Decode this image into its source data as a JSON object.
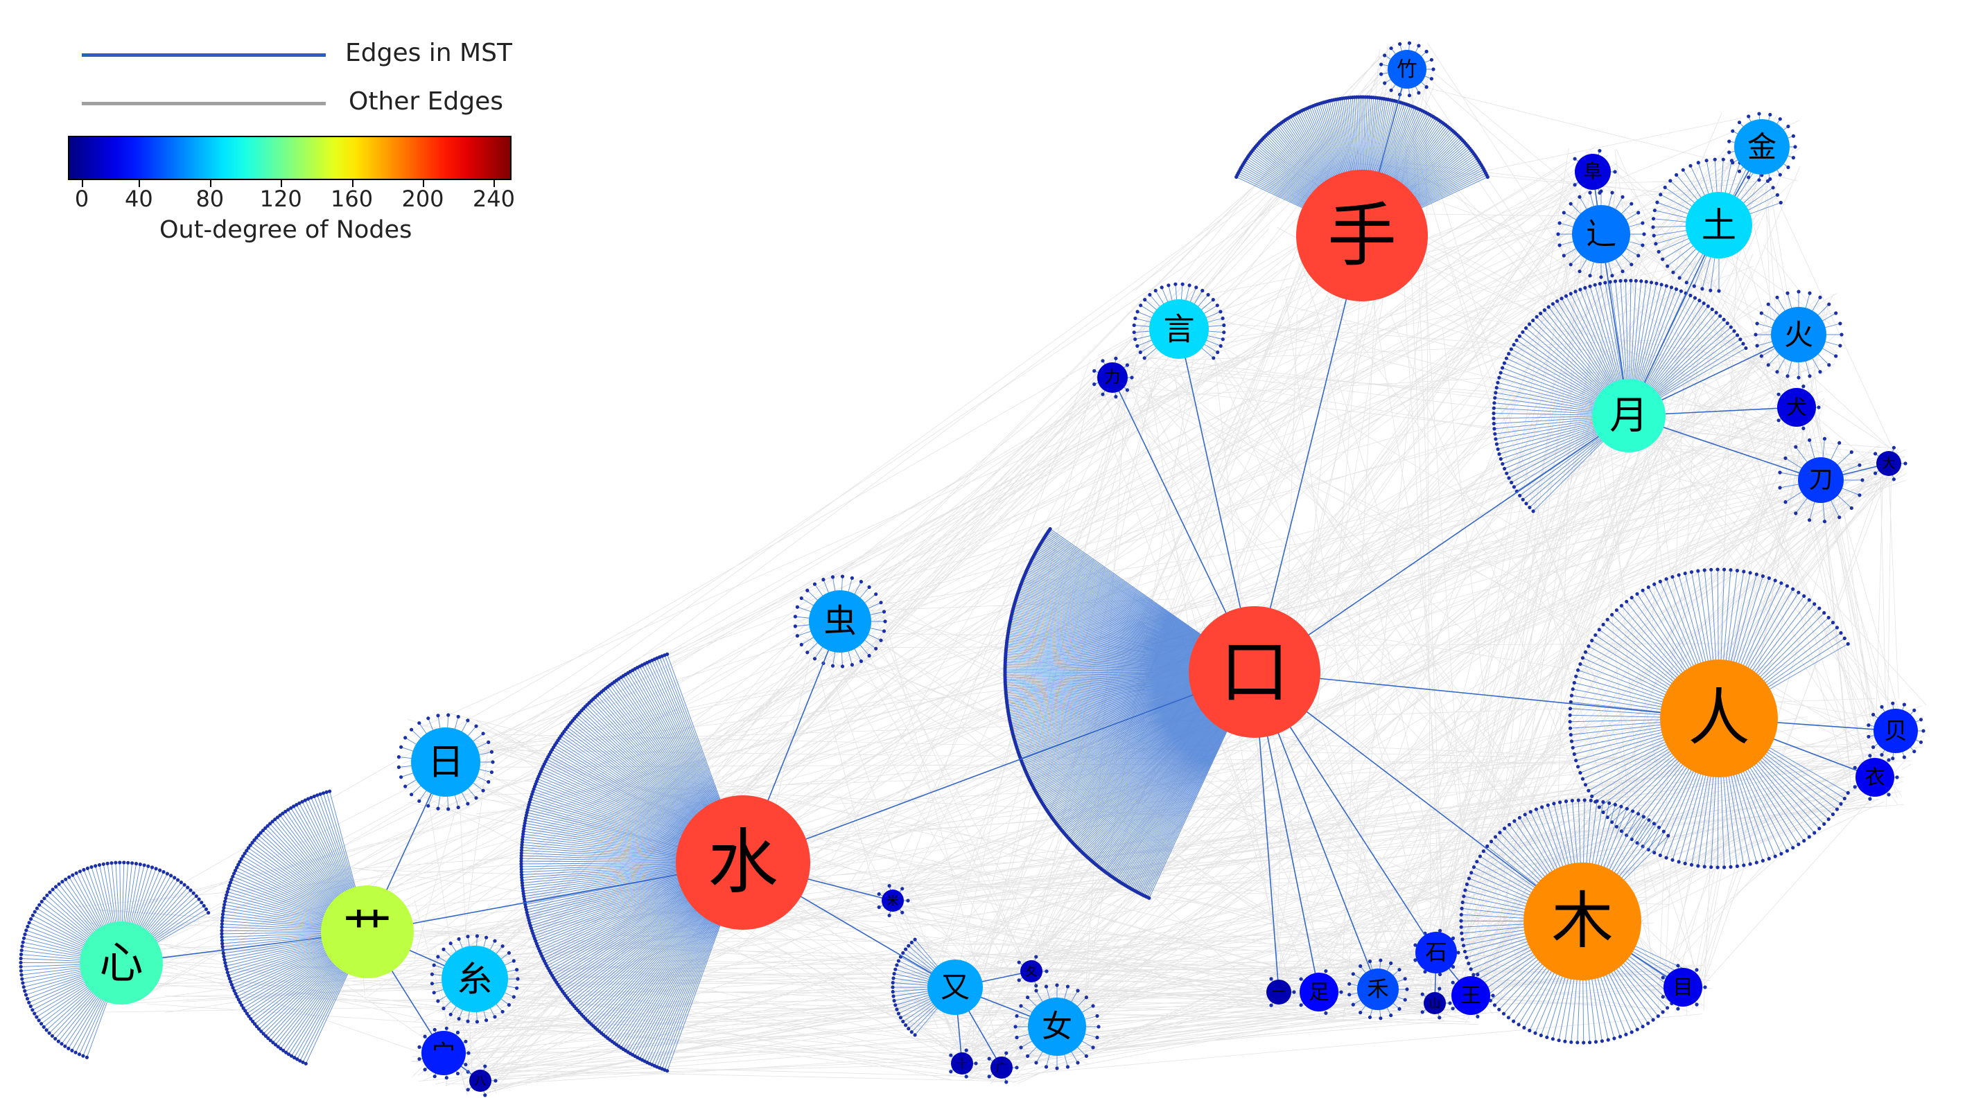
{
  "legend": {
    "mst_label": "Edges in MST",
    "other_label": "Other Edges",
    "mst_color": "#2a5fc0",
    "other_color": "#a0a0a0"
  },
  "colorbar": {
    "label": "Out-degree of Nodes",
    "ticks": [
      "0",
      "40",
      "80",
      "120",
      "160",
      "200",
      "240"
    ],
    "colormap": "jet"
  },
  "nodes": [
    {
      "id": "kou",
      "label": "口",
      "degree": 240,
      "fan_count": 260,
      "fan_start": 115,
      "fan_end": 215,
      "fan_radius": 360
    },
    {
      "id": "shou",
      "label": "手",
      "degree": 240,
      "fan_count": 150,
      "fan_start": 205,
      "fan_end": 335,
      "fan_radius": 200
    },
    {
      "id": "shui",
      "label": "水",
      "degree": 238,
      "fan_count": 200,
      "fan_start": 110,
      "fan_end": 250,
      "fan_radius": 320
    },
    {
      "id": "ren",
      "label": "人",
      "degree": 190,
      "fan_count": 120,
      "fan_start": 30,
      "fan_end": 330,
      "fan_radius": 215
    },
    {
      "id": "mu",
      "label": "木",
      "degree": 185,
      "fan_count": 100,
      "fan_start": 25,
      "fan_end": 315,
      "fan_radius": 175
    },
    {
      "id": "cao",
      "label": "艹",
      "degree": 140,
      "fan_count": 110,
      "fan_start": 115,
      "fan_end": 255,
      "fan_radius": 210
    },
    {
      "id": "xin",
      "label": "心",
      "degree": 110,
      "fan_count": 95,
      "fan_start": 110,
      "fan_end": 330,
      "fan_radius": 145
    },
    {
      "id": "yue",
      "label": "月",
      "degree": 105,
      "fan_count": 90,
      "fan_start": 135,
      "fan_end": 330,
      "fan_radius": 195
    },
    {
      "id": "yan",
      "label": "言",
      "degree": 85,
      "fan_count": 30,
      "fan_start": 140,
      "fan_end": 400,
      "fan_radius": 65
    },
    {
      "id": "tu",
      "label": "土",
      "degree": 85,
      "fan_count": 35,
      "fan_start": 90,
      "fan_end": 340,
      "fan_radius": 95
    },
    {
      "id": "jin",
      "label": "金",
      "degree": 70,
      "fan_count": 20,
      "fan_start": 0,
      "fan_end": 360,
      "fan_radius": 48
    },
    {
      "id": "mi",
      "label": "糸",
      "degree": 80,
      "fan_count": 30,
      "fan_start": 0,
      "fan_end": 360,
      "fan_radius": 62
    },
    {
      "id": "ri",
      "label": "日",
      "degree": 72,
      "fan_count": 30,
      "fan_start": 0,
      "fan_end": 360,
      "fan_radius": 68
    },
    {
      "id": "chong",
      "label": "虫",
      "degree": 70,
      "fan_count": 30,
      "fan_start": 0,
      "fan_end": 360,
      "fan_radius": 65
    },
    {
      "id": "you",
      "label": "又",
      "degree": 72,
      "fan_count": 25,
      "fan_start": 130,
      "fan_end": 230,
      "fan_radius": 90
    },
    {
      "id": "nv",
      "label": "女",
      "degree": 70,
      "fan_count": 25,
      "fan_start": 0,
      "fan_end": 360,
      "fan_radius": 60
    },
    {
      "id": "huo",
      "label": "火",
      "degree": 66,
      "fan_count": 25,
      "fan_start": 0,
      "fan_end": 360,
      "fan_radius": 62
    },
    {
      "id": "chuo",
      "label": "辶",
      "degree": 60,
      "fan_count": 25,
      "fan_start": 0,
      "fan_end": 360,
      "fan_radius": 62
    },
    {
      "id": "zhu",
      "label": "竹",
      "degree": 55,
      "fan_count": 18,
      "fan_start": 0,
      "fan_end": 360,
      "fan_radius": 38
    },
    {
      "id": "he",
      "label": "禾",
      "degree": 50,
      "fan_count": 18,
      "fan_start": 0,
      "fan_end": 360,
      "fan_radius": 42
    },
    {
      "id": "dao",
      "label": "刀",
      "degree": 45,
      "fan_count": 18,
      "fan_start": 0,
      "fan_end": 360,
      "fan_radius": 60
    },
    {
      "id": "bei",
      "label": "贝",
      "degree": 40,
      "fan_count": 16,
      "fan_start": 0,
      "fan_end": 360,
      "fan_radius": 40
    },
    {
      "id": "shi",
      "label": "石",
      "degree": 40,
      "fan_count": 10,
      "fan_start": 0,
      "fan_end": 360,
      "fan_radius": 32
    },
    {
      "id": "mian",
      "label": "宀",
      "degree": 38,
      "fan_count": 14,
      "fan_start": 0,
      "fan_end": 360,
      "fan_radius": 36
    },
    {
      "id": "zu",
      "label": "足",
      "degree": 32,
      "fan_count": 6,
      "fan_start": 0,
      "fan_end": 360,
      "fan_radius": 32
    },
    {
      "id": "wang",
      "label": "王",
      "degree": 30,
      "fan_count": 6,
      "fan_start": 0,
      "fan_end": 360,
      "fan_radius": 32
    },
    {
      "id": "yi",
      "label": "衣",
      "degree": 28,
      "fan_count": 8,
      "fan_start": 0,
      "fan_end": 360,
      "fan_radius": 32
    },
    {
      "id": "mu2",
      "label": "目",
      "degree": 26,
      "fan_count": 8,
      "fan_start": 0,
      "fan_end": 360,
      "fan_radius": 32
    },
    {
      "id": "quan",
      "label": "犬",
      "degree": 24,
      "fan_count": 6,
      "fan_start": 0,
      "fan_end": 360,
      "fan_radius": 32
    },
    {
      "id": "fu",
      "label": "阜",
      "degree": 24,
      "fan_count": 6,
      "fan_start": 0,
      "fan_end": 360,
      "fan_radius": 32
    },
    {
      "id": "li",
      "label": "力",
      "degree": 20,
      "fan_count": 10,
      "fan_start": 0,
      "fan_end": 360,
      "fan_radius": 28
    },
    {
      "id": "mi2",
      "label": "米",
      "degree": 20,
      "fan_count": 8,
      "fan_start": 0,
      "fan_end": 360,
      "fan_radius": 22
    },
    {
      "id": "xi",
      "label": "夂",
      "degree": 16,
      "fan_count": 6,
      "fan_start": 0,
      "fan_end": 360,
      "fan_radius": 22
    },
    {
      "id": "shi10",
      "label": "十",
      "degree": 14,
      "fan_count": 6,
      "fan_start": 0,
      "fan_end": 360,
      "fan_radius": 20
    },
    {
      "id": "guang",
      "label": "广",
      "degree": 14,
      "fan_count": 6,
      "fan_start": 0,
      "fan_end": 360,
      "fan_radius": 22
    },
    {
      "id": "ba",
      "label": "八",
      "degree": 12,
      "fan_count": 6,
      "fan_start": 0,
      "fan_end": 360,
      "fan_radius": 22
    },
    {
      "id": "da",
      "label": "大",
      "degree": 14,
      "fan_count": 6,
      "fan_start": 0,
      "fan_end": 360,
      "fan_radius": 24
    },
    {
      "id": "shan",
      "label": "山",
      "degree": 12,
      "fan_count": 6,
      "fan_start": 0,
      "fan_end": 360,
      "fan_radius": 22
    },
    {
      "id": "yi1",
      "label": "一",
      "degree": 12,
      "fan_count": 4,
      "fan_start": 0,
      "fan_end": 360,
      "fan_radius": 22
    }
  ],
  "edges": [
    [
      "kou",
      "shou"
    ],
    [
      "kou",
      "shui"
    ],
    [
      "kou",
      "ren"
    ],
    [
      "kou",
      "mu"
    ],
    [
      "kou",
      "yue"
    ],
    [
      "kou",
      "yan"
    ],
    [
      "kou",
      "shi"
    ],
    [
      "kou",
      "zu"
    ],
    [
      "kou",
      "he"
    ],
    [
      "kou",
      "yi1"
    ],
    [
      "kou",
      "li"
    ],
    [
      "shui",
      "cao"
    ],
    [
      "shui",
      "chong"
    ],
    [
      "shui",
      "you"
    ],
    [
      "shui",
      "mi2"
    ],
    [
      "cao",
      "xin"
    ],
    [
      "cao",
      "ri"
    ],
    [
      "cao",
      "mi"
    ],
    [
      "cao",
      "mian"
    ],
    [
      "you",
      "nv"
    ],
    [
      "you",
      "xi"
    ],
    [
      "you",
      "shi10"
    ],
    [
      "you",
      "guang"
    ],
    [
      "mian",
      "ba"
    ],
    [
      "shou",
      "zhu"
    ],
    [
      "yue",
      "chuo"
    ],
    [
      "yue",
      "tu"
    ],
    [
      "yue",
      "huo"
    ],
    [
      "yue",
      "quan"
    ],
    [
      "yue",
      "dao"
    ],
    [
      "chuo",
      "fu"
    ],
    [
      "tu",
      "jin"
    ],
    [
      "dao",
      "da"
    ],
    [
      "ren",
      "bei"
    ],
    [
      "ren",
      "yi"
    ],
    [
      "mu",
      "mu2"
    ],
    [
      "shi",
      "wang"
    ],
    [
      "shi",
      "shan"
    ]
  ]
}
